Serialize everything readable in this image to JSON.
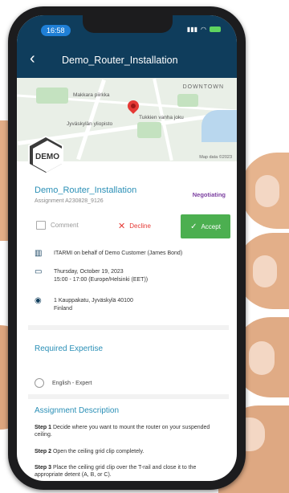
{
  "status_bar": {
    "time": "16:58"
  },
  "app_bar": {
    "back_icon": "chevron-left-icon",
    "title": "Demo_Router_Installation"
  },
  "map": {
    "labels": [
      "DOWNTOWN",
      "Makkara\npiirkka",
      "Jyväskylän\nyliopisto",
      "Tukkien vanha joku"
    ],
    "credit": "Map data ©2023"
  },
  "logo_text": "DEMO",
  "assignment": {
    "title": "Demo_Router_Installation",
    "number": "Assignment A230828_9126",
    "status": "Negotiating"
  },
  "actions": {
    "comment": "Comment",
    "decline": "Decline",
    "accept": "Accept"
  },
  "details": {
    "org": "ITARMI on behalf of Demo Customer (James Bond)",
    "date_line1": "Thursday, October 19, 2023",
    "date_line2": "15:00 - 17:00  (Europe/Helsinki (EET))",
    "address_line1": "1 Kauppakatu, Jyväskylä 40100",
    "address_line2": "Finland"
  },
  "required_expertise": {
    "title": "Required Expertise",
    "item": "English - Expert"
  },
  "description": {
    "title": "Assignment Description",
    "steps": [
      {
        "label": "Step 1",
        "text": "Decide where you want to mount the router on your suspended ceiling."
      },
      {
        "label": "Step 2",
        "text": "Open the ceiling grid clip completely."
      },
      {
        "label": "Step 3",
        "text": "Place the ceiling grid clip over the T-rail and close it to the appropriate detent (A, B, or C)."
      }
    ]
  },
  "colors": {
    "header": "#0f3d5c",
    "accent": "#2a8fb6",
    "accept": "#4caf50",
    "decline": "#e53935",
    "status": "#7b3fa0"
  }
}
